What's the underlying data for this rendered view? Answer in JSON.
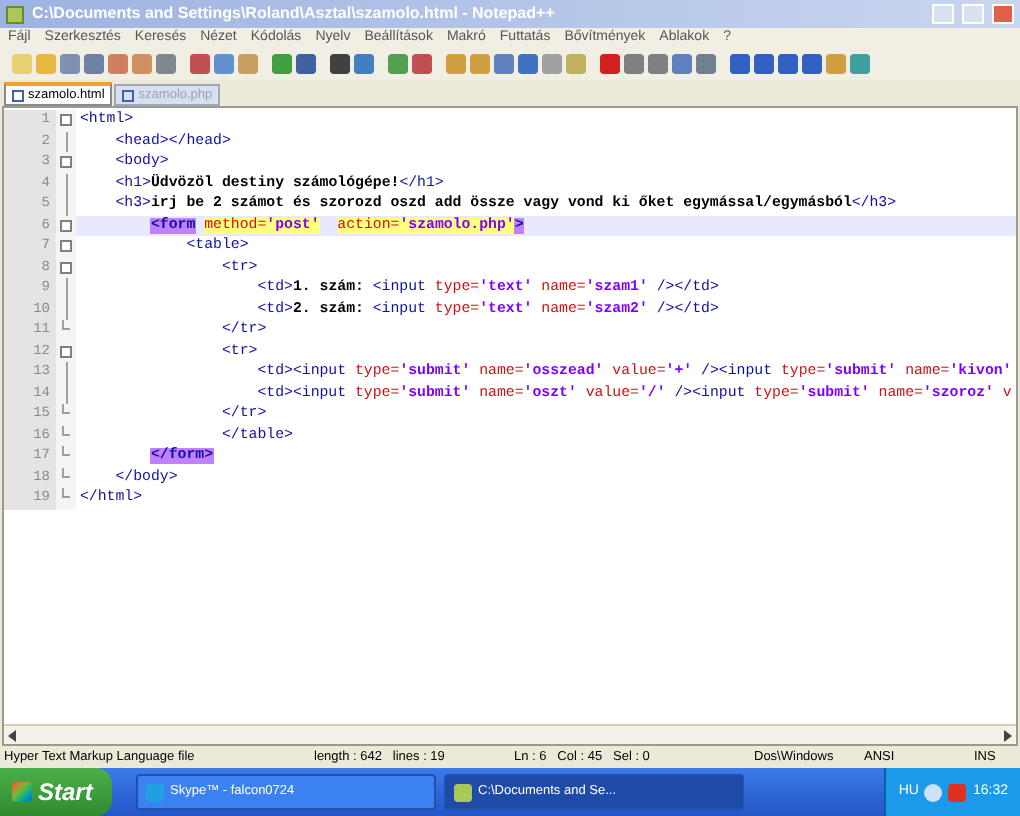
{
  "window": {
    "title": "C:\\Documents and Settings\\Roland\\Asztal\\szamolo.html - Notepad++"
  },
  "menu": [
    "Fájl",
    "Szerkesztés",
    "Keresés",
    "Nézet",
    "Kódolás",
    "Nyelv",
    "Beállítások",
    "Makró",
    "Futtatás",
    "Bővítmények",
    "Ablakok",
    "?"
  ],
  "tabs": [
    {
      "label": "szamolo.html",
      "selected": true
    },
    {
      "label": "szamolo.php",
      "selected": false
    }
  ],
  "editor": {
    "lines": [
      {
        "number": "1",
        "kind": "foldstart",
        "current": false,
        "tokens": [
          {
            "kind": "tag",
            "text": "<html>"
          }
        ]
      },
      {
        "number": "2",
        "kind": "foldbody",
        "current": false,
        "tokens": [
          {
            "kind": "tag",
            "text": "    <head></head>"
          }
        ]
      },
      {
        "number": "3",
        "kind": "foldstart",
        "current": false,
        "tokens": [
          {
            "kind": "tag",
            "text": "    <body>"
          }
        ]
      },
      {
        "number": "4",
        "kind": "foldbody",
        "current": false,
        "tokens": [
          {
            "kind": "tag",
            "text": "    <h1>"
          },
          {
            "kind": "text",
            "text": "Üdvözöl destiny számológépe!"
          },
          {
            "kind": "tag",
            "text": "</h1>"
          }
        ]
      },
      {
        "number": "5",
        "kind": "foldbody",
        "current": false,
        "tokens": [
          {
            "kind": "tag",
            "text": "    <h3>"
          },
          {
            "kind": "text",
            "text": "irj be 2 számot és szorozd oszd add össze vagy vond ki őket egymással/egymásból"
          },
          {
            "kind": "tag",
            "text": "</h3>"
          }
        ]
      },
      {
        "number": "6",
        "kind": "foldstart",
        "current": true,
        "tokens": [
          {
            "kind": "match",
            "text": "        <form"
          },
          {
            "kind": "attr-hl",
            "text": " method="
          },
          {
            "kind": "value-hl",
            "text": "'post'"
          },
          {
            "kind": "attr-hl",
            "text": "  action="
          },
          {
            "kind": "value-hl",
            "text": "'szamolo.php'"
          },
          {
            "kind": "match",
            "text": ">"
          }
        ]
      },
      {
        "number": "7",
        "kind": "foldstart",
        "current": false,
        "tokens": [
          {
            "kind": "tag",
            "text": "            <table>"
          }
        ]
      },
      {
        "number": "8",
        "kind": "foldstart",
        "current": false,
        "tokens": [
          {
            "kind": "tag",
            "text": "                <tr>"
          }
        ]
      },
      {
        "number": "9",
        "kind": "foldbody",
        "current": false,
        "tokens": [
          {
            "kind": "tag",
            "text": "                    <td>"
          },
          {
            "kind": "text",
            "text": "1. szám: "
          },
          {
            "kind": "tag",
            "text": "<input "
          },
          {
            "kind": "attr",
            "text": "type="
          },
          {
            "kind": "value",
            "text": "'text'"
          },
          {
            "kind": "attr",
            "text": " name="
          },
          {
            "kind": "value",
            "text": "'szam1'"
          },
          {
            "kind": "tag",
            "text": " /></td>"
          }
        ]
      },
      {
        "number": "10",
        "kind": "foldbody",
        "current": false,
        "tokens": [
          {
            "kind": "tag",
            "text": "                    <td>"
          },
          {
            "kind": "text",
            "text": "2. szám: "
          },
          {
            "kind": "tag",
            "text": "<input "
          },
          {
            "kind": "attr",
            "text": "type="
          },
          {
            "kind": "value",
            "text": "'text'"
          },
          {
            "kind": "attr",
            "text": " name="
          },
          {
            "kind": "value",
            "text": "'szam2'"
          },
          {
            "kind": "tag",
            "text": " /></td>"
          }
        ]
      },
      {
        "number": "11",
        "kind": "foldend",
        "current": false,
        "tokens": [
          {
            "kind": "tag",
            "text": "                </tr>"
          }
        ]
      },
      {
        "number": "12",
        "kind": "foldstart",
        "current": false,
        "tokens": [
          {
            "kind": "tag",
            "text": "                <tr>"
          }
        ]
      },
      {
        "number": "13",
        "kind": "foldbody",
        "current": false,
        "tokens": [
          {
            "kind": "tag",
            "text": "                    <td><input "
          },
          {
            "kind": "attr",
            "text": "type="
          },
          {
            "kind": "value",
            "text": "'submit'"
          },
          {
            "kind": "attr",
            "text": " name="
          },
          {
            "kind": "value",
            "text": "'osszead'"
          },
          {
            "kind": "attr",
            "text": " value="
          },
          {
            "kind": "value",
            "text": "'+'"
          },
          {
            "kind": "tag",
            "text": " /><input "
          },
          {
            "kind": "attr",
            "text": "type="
          },
          {
            "kind": "value",
            "text": "'submit'"
          },
          {
            "kind": "attr",
            "text": " name="
          },
          {
            "kind": "value",
            "text": "'kivon'"
          }
        ]
      },
      {
        "number": "14",
        "kind": "foldbody",
        "current": false,
        "tokens": [
          {
            "kind": "tag",
            "text": "                    <td><input "
          },
          {
            "kind": "attr",
            "text": "type="
          },
          {
            "kind": "value",
            "text": "'submit'"
          },
          {
            "kind": "attr",
            "text": " name="
          },
          {
            "kind": "value",
            "text": "'oszt'"
          },
          {
            "kind": "attr",
            "text": " value="
          },
          {
            "kind": "value",
            "text": "'/'"
          },
          {
            "kind": "tag",
            "text": " /><input "
          },
          {
            "kind": "attr",
            "text": "type="
          },
          {
            "kind": "value",
            "text": "'submit'"
          },
          {
            "kind": "attr",
            "text": " name="
          },
          {
            "kind": "value",
            "text": "'szoroz'"
          },
          {
            "kind": "attr",
            "text": " v"
          }
        ]
      },
      {
        "number": "15",
        "kind": "foldend",
        "current": false,
        "tokens": [
          {
            "kind": "tag",
            "text": "                </tr>"
          }
        ]
      },
      {
        "number": "16",
        "kind": "foldend",
        "current": false,
        "tokens": [
          {
            "kind": "tag",
            "text": "                </table>"
          }
        ]
      },
      {
        "number": "17",
        "kind": "foldend",
        "current": false,
        "tokens": [
          {
            "kind": "match",
            "text": "        </form>"
          }
        ]
      },
      {
        "number": "18",
        "kind": "foldend",
        "current": false,
        "tokens": [
          {
            "kind": "tag",
            "text": "    </body>"
          }
        ]
      },
      {
        "number": "19",
        "kind": "foldend",
        "current": false,
        "tokens": [
          {
            "kind": "tag",
            "text": "</html>"
          }
        ]
      }
    ]
  },
  "status_bar": [
    "Hyper Text Markup Language file",
    "length : 642   lines : 19",
    "Ln : 6   Col : 45   Sel : 0",
    "Dos\\Windows",
    "ANSI",
    "INS"
  ],
  "taskbar": {
    "start": "Start",
    "windows": [
      {
        "label": "Skype™ - falcon0724",
        "selected": false
      },
      {
        "label": "C:\\Documents and Se...",
        "selected": true
      }
    ],
    "language": "HU",
    "clock": "16:32"
  }
}
